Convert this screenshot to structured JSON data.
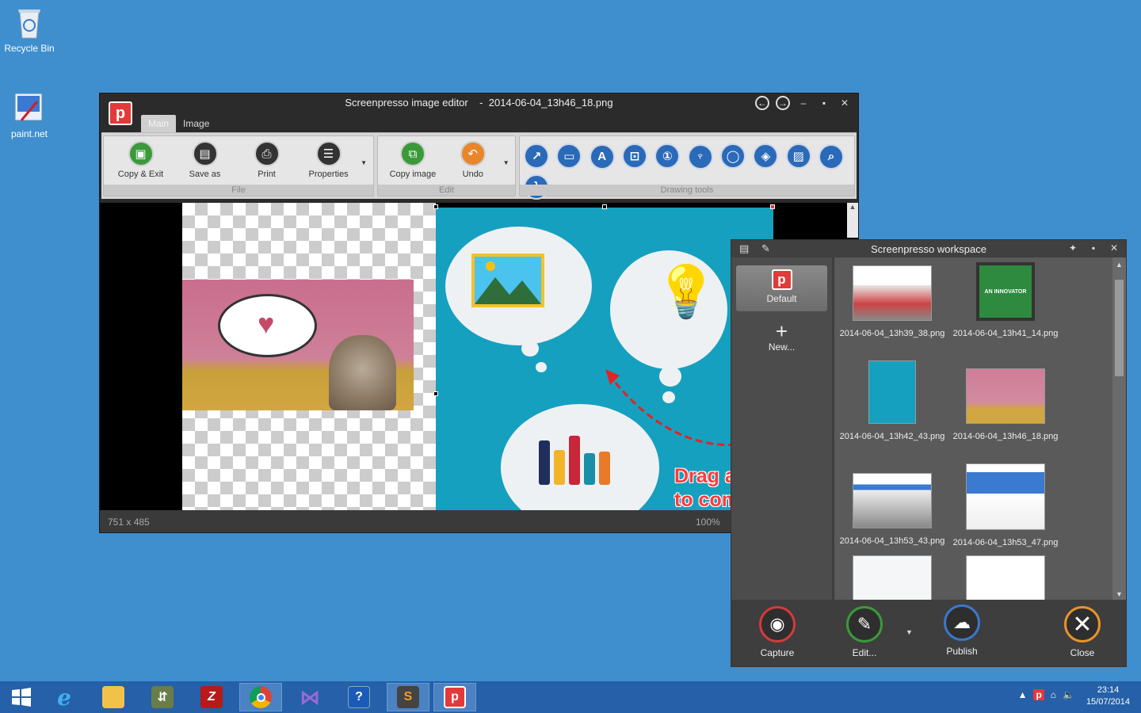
{
  "desktop": {
    "icons": [
      {
        "label": "Recycle Bin"
      },
      {
        "label": "paint.net"
      }
    ]
  },
  "editor": {
    "title": "Screenpresso image editor",
    "filename": "2014-06-04_13h46_18.png",
    "tabs": [
      "Main",
      "Image"
    ],
    "groups": {
      "file": {
        "label": "File",
        "buttons": [
          "Copy & Exit",
          "Save as",
          "Print",
          "Properties"
        ]
      },
      "edit": {
        "label": "Edit",
        "buttons": [
          "Copy image",
          "Undo"
        ]
      },
      "drawing": {
        "label": "Drawing tools"
      }
    },
    "overlay_text_line1": "Drag and drop",
    "overlay_text_line2": "to combine",
    "status_dimensions": "751 x 485",
    "status_zoom": "100%"
  },
  "workspace": {
    "title": "Screenpresso workspace",
    "default_label": "Default",
    "new_label": "New...",
    "thumbnails": [
      "2014-06-04_13h39_38.png",
      "2014-06-04_13h41_14.png",
      "2014-06-04_13h42_43.png",
      "2014-06-04_13h46_18.png",
      "2014-06-04_13h53_43.png",
      "2014-06-04_13h53_47.png"
    ],
    "innovator_text": "AN INNOVATOR",
    "buttons": {
      "capture": "Capture",
      "edit": "Edit...",
      "publish": "Publish",
      "close": "Close"
    }
  },
  "taskbar": {
    "time": "23:14",
    "date": "15/07/2014"
  },
  "colors": {
    "desktop": "#3f8fcf",
    "accent_red": "#e23a3a",
    "tool_blue": "#2a6ab8",
    "teal_canvas": "#16a0bf"
  }
}
